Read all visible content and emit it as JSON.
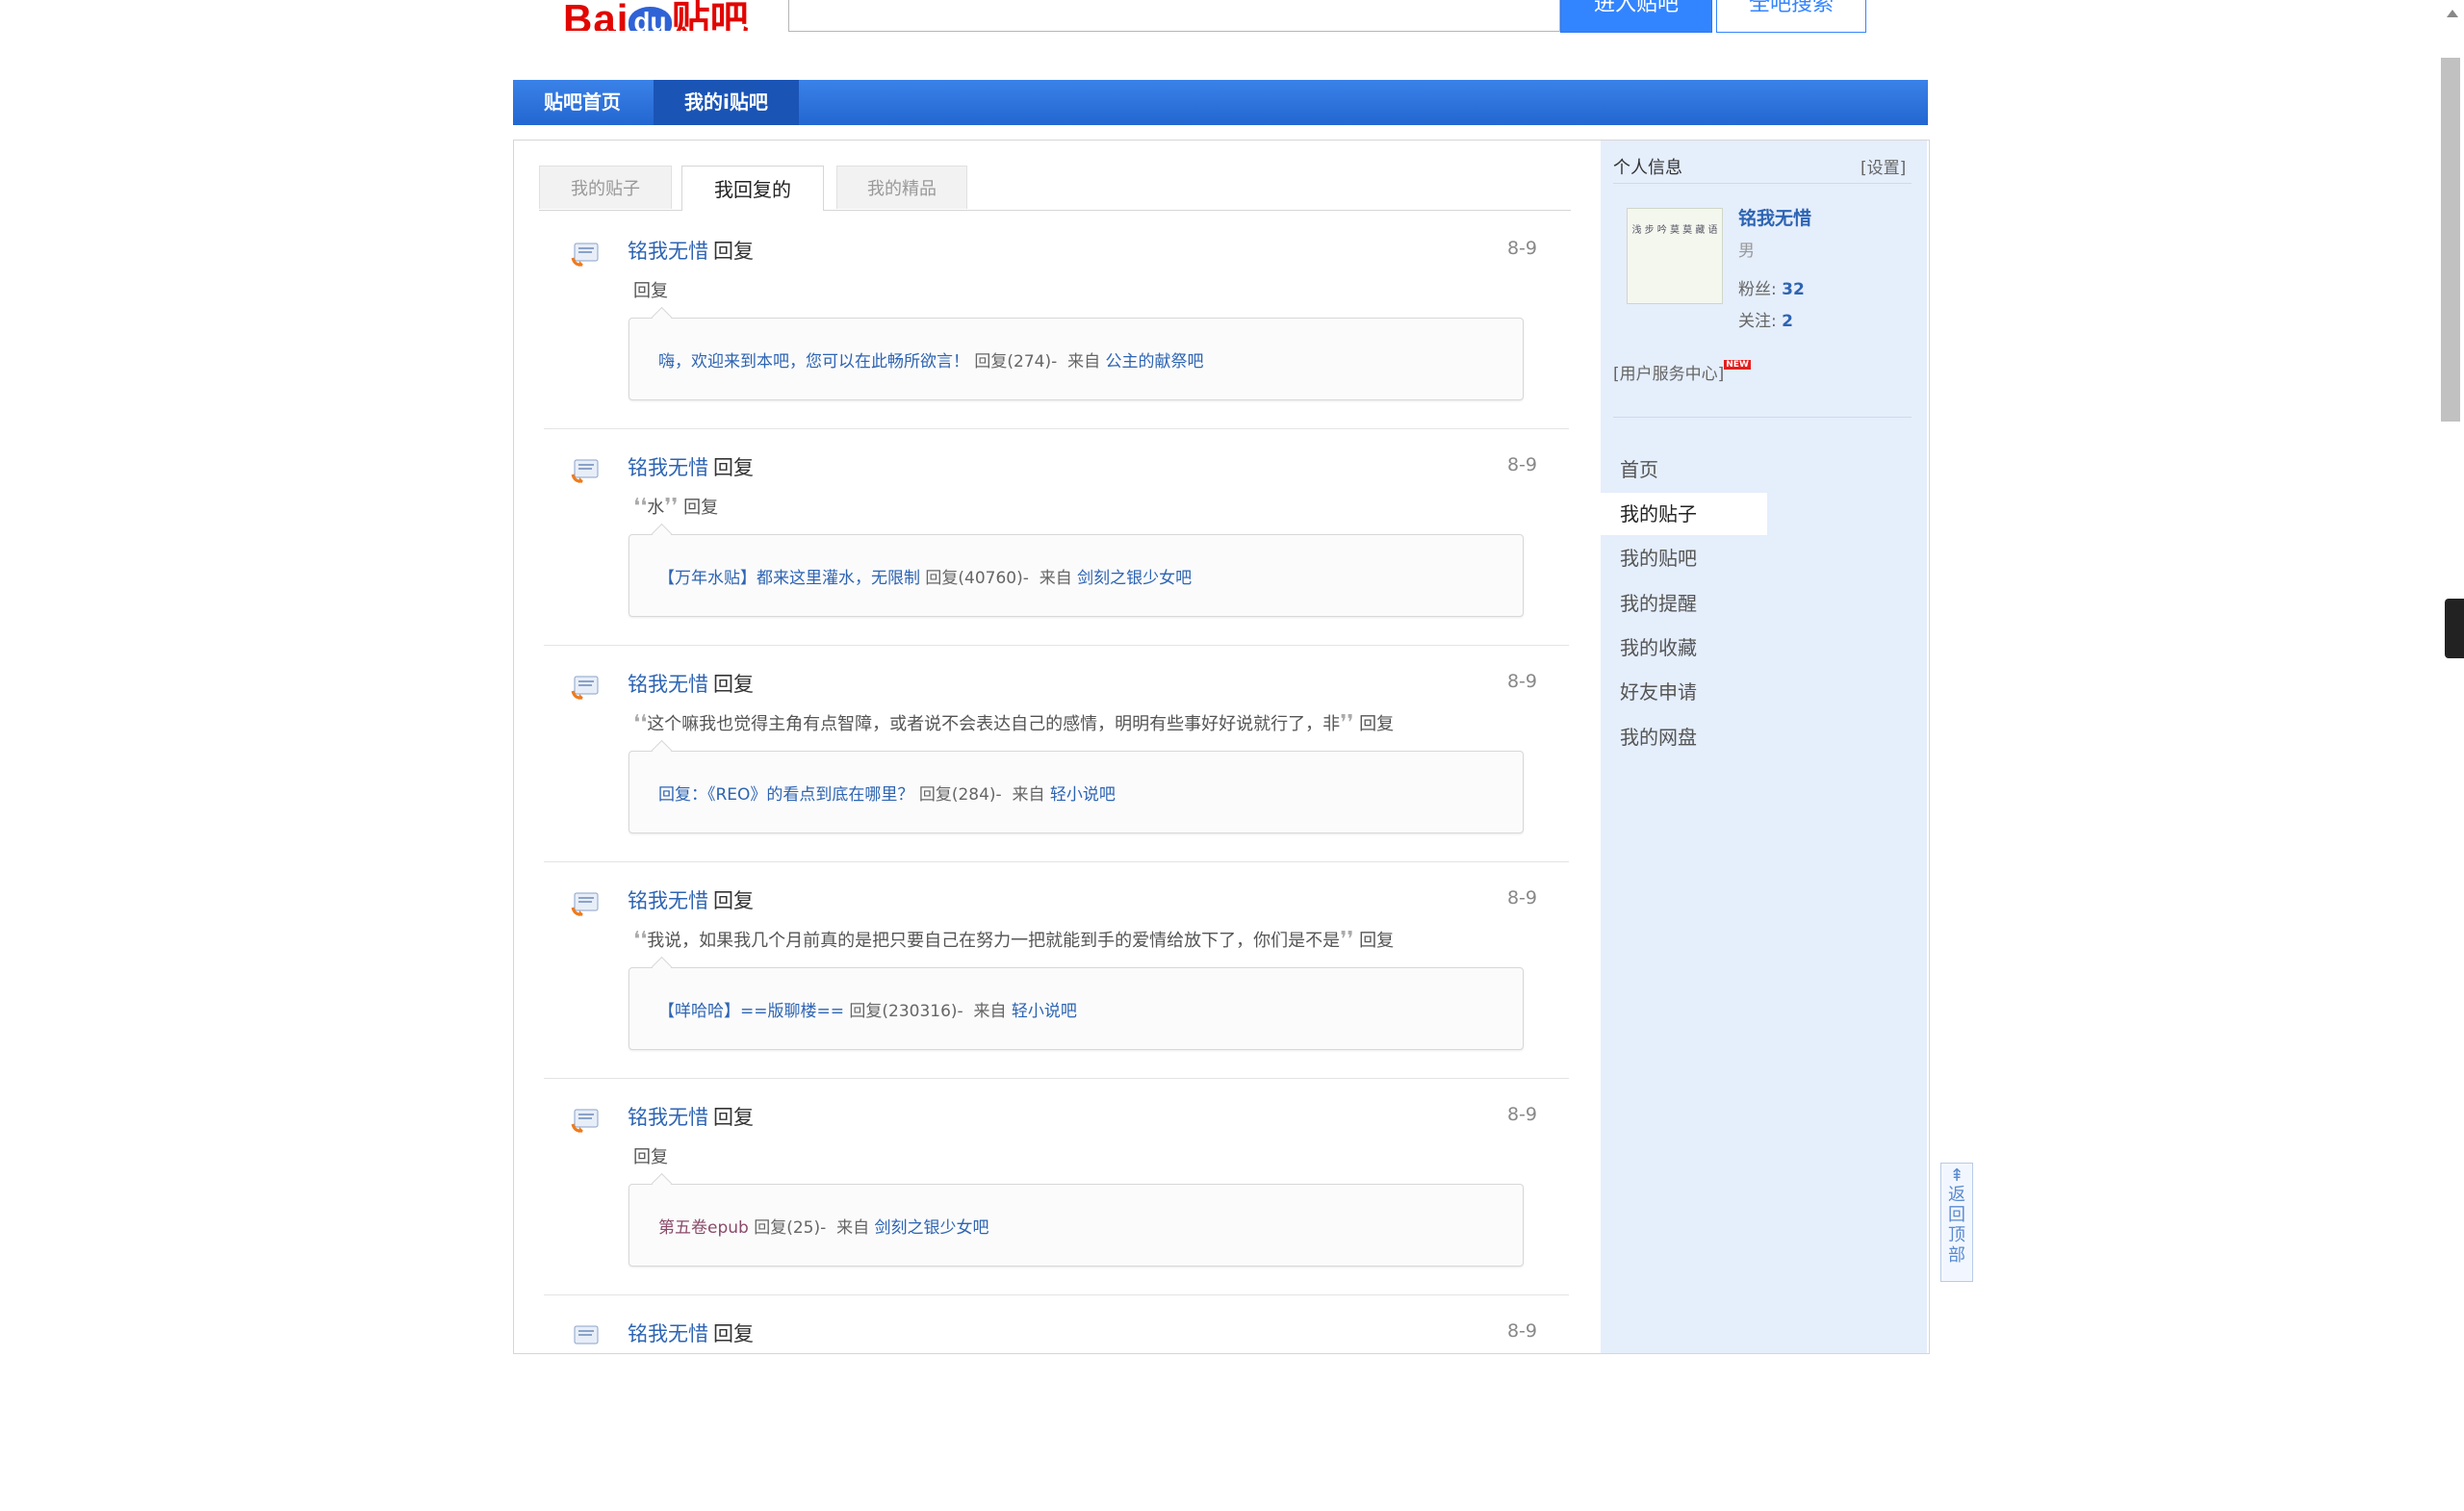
{
  "header": {
    "logo_bai": "Bai",
    "logo_du": "du",
    "logo_tieba": "贴吧",
    "enter_button": "进入贴吧",
    "search_button": "全吧搜索"
  },
  "nav": {
    "items": [
      "贴吧首页",
      "我的i贴吧"
    ],
    "active_index": 1
  },
  "tabs": [
    "我的贴子",
    "我回复的",
    "我的精品"
  ],
  "posts": [
    {
      "author": "铭我无惜",
      "action": "回复",
      "date": "8-9",
      "quote": "",
      "quote_suffix": "回复",
      "content": "嗨，欢迎来到本吧，您可以在此畅所欲言！",
      "reply_count": "回复(274)-",
      "source_label": "来自",
      "bar": "公主的献祭吧"
    },
    {
      "author": "铭我无惜",
      "action": "回复",
      "date": "8-9",
      "quote": "水",
      "quote_suffix": "回复",
      "content": "【万年水贴】都来这里灌水，无限制",
      "reply_count": "回复(40760)-",
      "source_label": "来自",
      "bar": "剑刻之银少女吧"
    },
    {
      "author": "铭我无惜",
      "action": "回复",
      "date": "8-9",
      "quote": "这个嘛我也觉得主角有点智障，或者说不会表达自己的感情，明明有些事好好说就行了，非",
      "quote_suffix": "回复",
      "content": "回复：《REO》的看点到底在哪里？",
      "reply_count": "回复(284)-",
      "source_label": "来自",
      "bar": "轻小说吧"
    },
    {
      "author": "铭我无惜",
      "action": "回复",
      "date": "8-9",
      "quote": "我说，如果我几个月前真的是把只要自己在努力一把就能到手的爱情给放下了，你们是不是",
      "quote_suffix": "回复",
      "content": "【咩哈哈】==版聊楼==",
      "reply_count": "回复(230316)-",
      "source_label": "来自",
      "bar": "轻小说吧"
    },
    {
      "author": "铭我无惜",
      "action": "回复",
      "date": "8-9",
      "quote": "",
      "quote_suffix": "回复",
      "content": "第五卷epub",
      "reply_count": "回复(25)-",
      "source_label": "来自",
      "bar": "剑刻之银少女吧"
    },
    {
      "author": "铭我无惜",
      "action": "回复",
      "date": "8-9",
      "quote": "",
      "quote_suffix": "",
      "content": "",
      "reply_count": "",
      "source_label": "",
      "bar": ""
    }
  ],
  "profile": {
    "section_title": "个人信息",
    "settings_link": "[设置]",
    "avatar_text": "浅 步 吟 莫 莫 藏 语",
    "username": "铭我无惜",
    "gender": "男",
    "fans_label": "粉丝:",
    "fans_count": "32",
    "follow_label": "关注:",
    "follow_count": "2",
    "service_center": "[用户服务中心]",
    "new_badge": "NEW"
  },
  "side_menu": {
    "items": [
      "首页",
      "我的贴子",
      "我的贴吧",
      "我的提醒",
      "我的收藏",
      "好友申请",
      "我的网盘"
    ],
    "active_index": 1
  },
  "back_top": {
    "label": "返回顶部"
  },
  "colors": {
    "nav_bar": "#2a6fda",
    "link": "#2d64b3",
    "sidebar_bg": "#e5eefb",
    "logo_red": "#e10601",
    "button_blue": "#3385ff"
  }
}
